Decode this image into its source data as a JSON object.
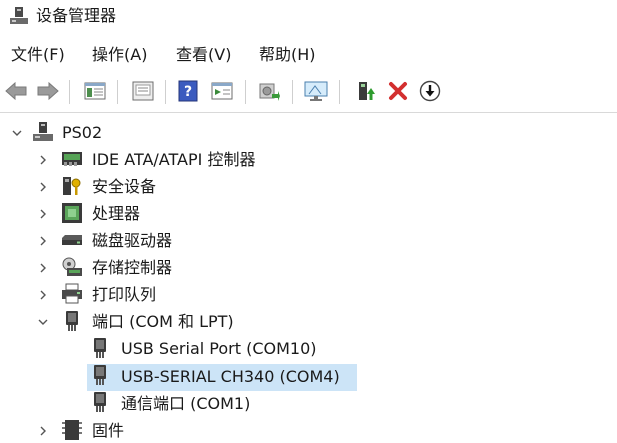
{
  "window": {
    "title": "设备管理器"
  },
  "menu": [
    {
      "label": "文件(F)"
    },
    {
      "label": "操作(A)"
    },
    {
      "label": "查看(V)"
    },
    {
      "label": "帮助(H)"
    }
  ],
  "toolbar": {
    "buttons": [
      "back",
      "forward",
      "properties",
      "show-hide",
      "help",
      "run",
      "scan",
      "monitor",
      "enable",
      "uninstall",
      "update"
    ]
  },
  "tree": {
    "root": "PS02",
    "categories": [
      {
        "label": "IDE ATA/ATAPI 控制器"
      },
      {
        "label": "安全设备"
      },
      {
        "label": "处理器"
      },
      {
        "label": "磁盘驱动器"
      },
      {
        "label": "存储控制器"
      },
      {
        "label": "打印队列"
      },
      {
        "label": "端口 (COM 和 LPT)"
      },
      {
        "label": "固件"
      }
    ],
    "ports": [
      {
        "label": "USB Serial Port (COM10)"
      },
      {
        "label": "USB-SERIAL CH340 (COM4)",
        "selected": true
      },
      {
        "label": "通信端口 (COM1)"
      }
    ]
  },
  "colors": {
    "selection": "#cce4f7",
    "help_blue": "#3b5bbf",
    "uninstall_red": "#d32f2f"
  }
}
